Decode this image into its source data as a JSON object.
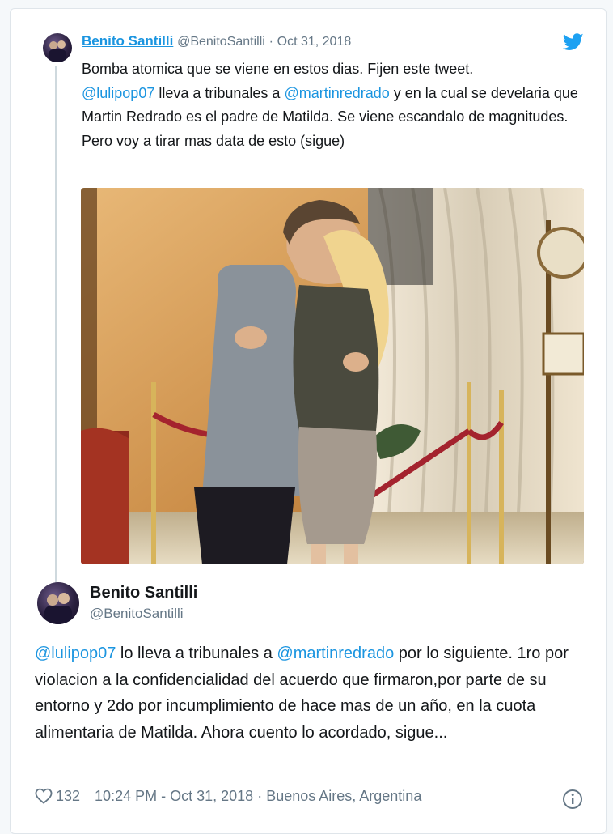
{
  "tweet1": {
    "author_name": "Benito Santilli",
    "handle": "@BenitoSantilli",
    "separator": "·",
    "date": "Oct 31, 2018",
    "line1": "Bomba atomica que se viene en estos dias. Fijen este tweet.",
    "mention1": "@lulipop07",
    "mid1": " lleva a tribunales a ",
    "mention2": "@martinredrado",
    "tail1": " y en la cual se develaria que Martin Redrado es el padre de Matilda. Se viene escandalo de magnitudes. Pero voy a tirar mas data de esto (sigue)",
    "icons": {
      "brand": "twitter-bird-icon"
    }
  },
  "tweet2": {
    "author_name": "Benito Santilli",
    "handle": "@BenitoSantilli",
    "mention1": "@lulipop07",
    "mid1": " lo lleva a tribunales a ",
    "mention2": "@martinredrado",
    "tail": "  por lo siguiente. 1ro por violacion a la confidencialidad del acuerdo que firmaron,por parte de su entorno y 2do por incumplimiento de hace mas de un año, en la cuota alimentaria de Matilda. Ahora cuento lo acordado, sigue...",
    "likes": "132",
    "time": "10:24 PM - Oct 31, 2018",
    "separator": "·",
    "location": "Buenos Aires, Argentina",
    "icons": {
      "like": "heart-icon",
      "info": "info-icon"
    }
  },
  "colors": {
    "link": "#1b95e0",
    "secondary": "#657786",
    "text": "#14171a",
    "thread": "#cfd9de"
  }
}
